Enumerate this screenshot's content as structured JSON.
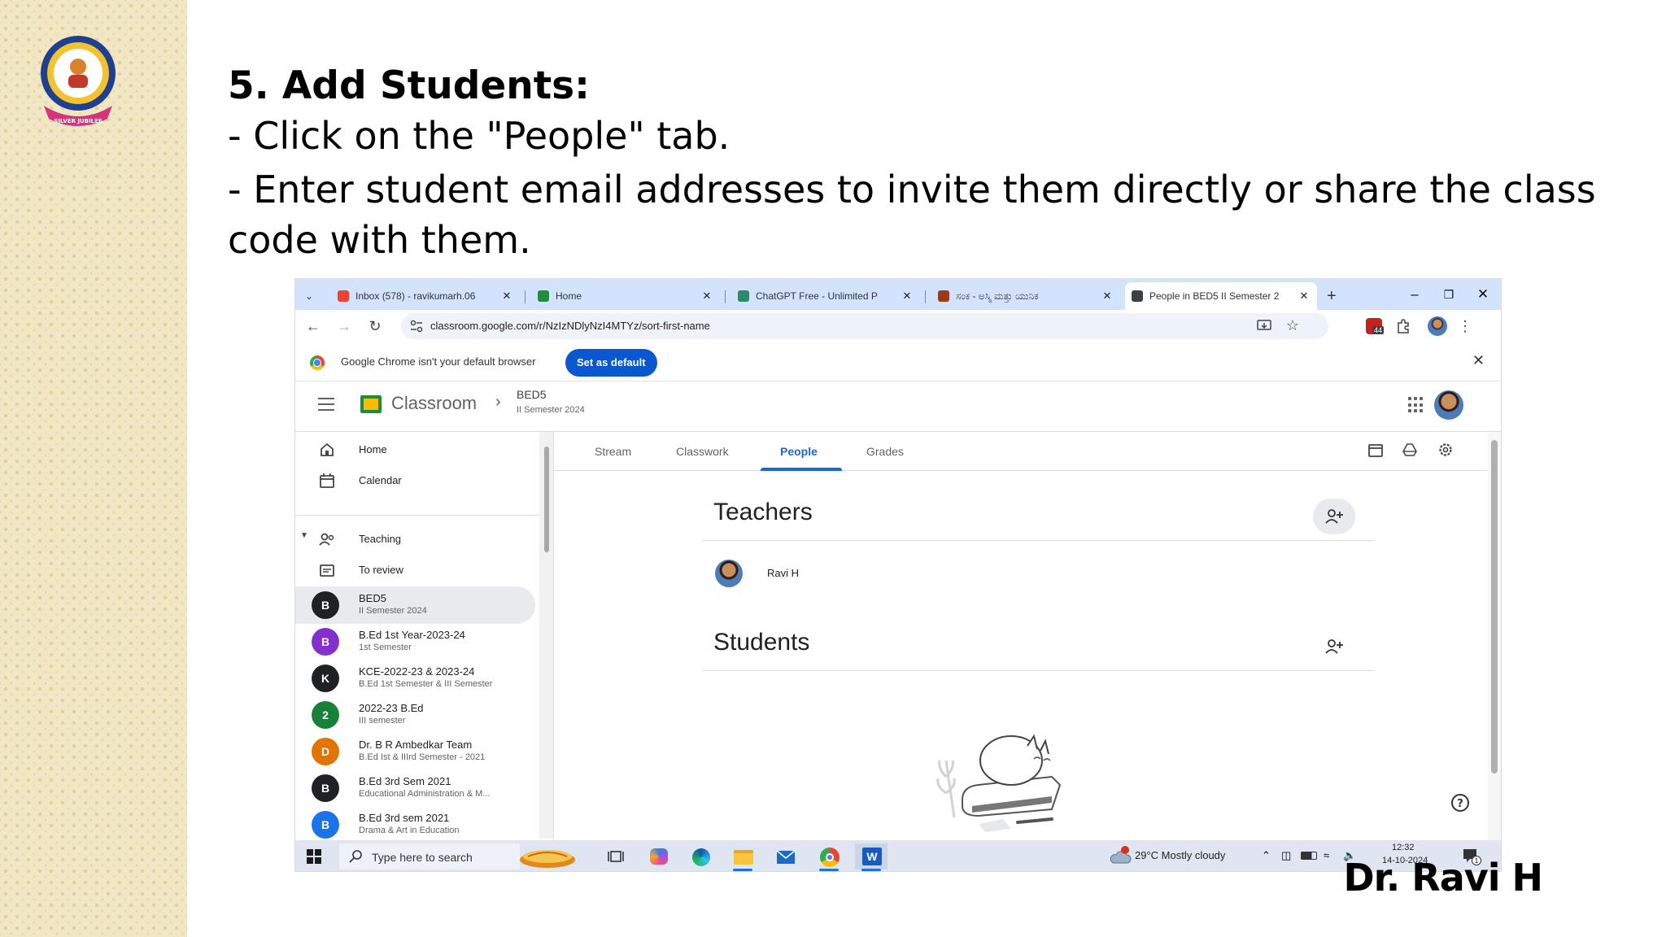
{
  "slide": {
    "title": "5. Add Students:",
    "bullets": [
      "- Click on the \"People\" tab.",
      "- Enter student email addresses to invite them directly or share the class code with them."
    ],
    "author": "Dr. Ravi H",
    "logo_text": "SILVER JUBILEE"
  },
  "browser": {
    "tabs": [
      {
        "title": "Inbox (578) - ravikumarh.06",
        "icon": "gmail-icon",
        "color": "#ea4335"
      },
      {
        "title": "Home",
        "icon": "classroom-icon",
        "color": "#1e8e3e"
      },
      {
        "title": "ChatGPT Free - Unlimited P",
        "icon": "chatgpt-icon",
        "color": "#2a8a6a"
      },
      {
        "title": "ಸಂಕ - ಅಸ್ಮಿ ಮತ್ತು ಯುನಿಕ",
        "icon": "site-icon",
        "color": "#9c3a12"
      },
      {
        "title": "People in BED5 II Semester 2",
        "icon": "classroom-icon",
        "color": "#3c4043"
      }
    ],
    "url": "classroom.google.com/r/NzIzNDlyNzI4MTYz/sort-first-name",
    "extension_badge": "44",
    "infobar": {
      "message": "Google Chrome isn't your default browser",
      "button": "Set as default"
    }
  },
  "classroom": {
    "app_name": "Classroom",
    "class_name": "BED5",
    "class_section": "II Semester 2024",
    "nav": {
      "home": "Home",
      "calendar": "Calendar",
      "teaching": "Teaching",
      "to_review": "To review"
    },
    "classes": [
      {
        "letter": "B",
        "title": "BED5",
        "sub": "II Semester 2024",
        "color": "#202124"
      },
      {
        "letter": "B",
        "title": "B.Ed 1st Year-2023-24",
        "sub": "1st Semester",
        "color": "#8430ce"
      },
      {
        "letter": "K",
        "title": "KCE-2022-23 & 2023-24",
        "sub": "B.Ed 1st Semester & III Semester",
        "color": "#202124"
      },
      {
        "letter": "2",
        "title": "2022-23 B.Ed",
        "sub": "III semester",
        "color": "#188038"
      },
      {
        "letter": "D",
        "title": "Dr. B R Ambedkar Team",
        "sub": "B.Ed Ist & IIIrd Semester - 2021",
        "color": "#e37400"
      },
      {
        "letter": "B",
        "title": "B.Ed 3rd Sem 2021",
        "sub": "Educational Administration & M...",
        "color": "#202124"
      },
      {
        "letter": "B",
        "title": "B.Ed 3rd sem 2021",
        "sub": "Drama & Art in Education",
        "color": "#1a73e8"
      }
    ],
    "tabs": [
      "Stream",
      "Classwork",
      "People",
      "Grades"
    ],
    "active_tab": "People",
    "teachers_heading": "Teachers",
    "teacher_name": "Ravi H",
    "students_heading": "Students"
  },
  "taskbar": {
    "search_placeholder": "Type here to search",
    "weather": "29°C  Mostly cloudy",
    "time": "12:32",
    "date": "14-10-2024",
    "notification_count": "1"
  }
}
